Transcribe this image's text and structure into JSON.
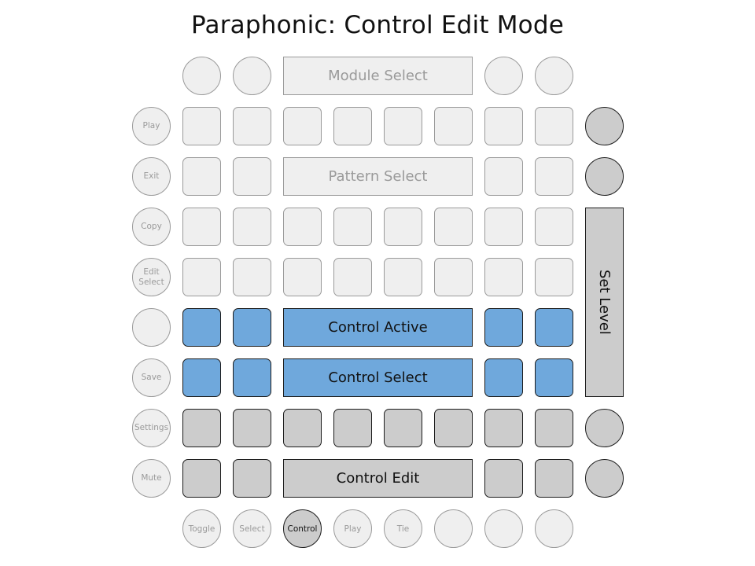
{
  "title": "Paraphonic: Control Edit Mode",
  "colors": {
    "idle_fill": "#efefef",
    "idle_border": "#9a9a9a",
    "blue_fill": "#6fa8dc",
    "gray_fill": "#cccccc",
    "dark_border": "#1c1c1c"
  },
  "side_buttons": [
    {
      "label": "Play",
      "icon": "round-button"
    },
    {
      "label": "Exit",
      "icon": "round-button"
    },
    {
      "label": "Copy",
      "icon": "round-button"
    },
    {
      "label": "Edit\nSelect",
      "icon": "round-button"
    },
    {
      "label": "",
      "icon": "round-button"
    },
    {
      "label": "Save",
      "icon": "round-button"
    },
    {
      "label": "Settings",
      "icon": "round-button"
    },
    {
      "label": "Mute",
      "icon": "round-button"
    }
  ],
  "bottom_buttons": [
    {
      "label": "Toggle",
      "active": false
    },
    {
      "label": "Select",
      "active": false
    },
    {
      "label": "Control",
      "active": true
    },
    {
      "label": "Play",
      "active": false
    },
    {
      "label": "Tie",
      "active": false
    },
    {
      "label": "",
      "active": false
    },
    {
      "label": "",
      "active": false
    },
    {
      "label": "",
      "active": false
    }
  ],
  "bars": {
    "module_select": "Module Select",
    "pattern_select": "Pattern Select",
    "control_active": "Control Active",
    "control_select": "Control Select",
    "control_edit": "Control Edit",
    "set_level": "Set Level"
  }
}
